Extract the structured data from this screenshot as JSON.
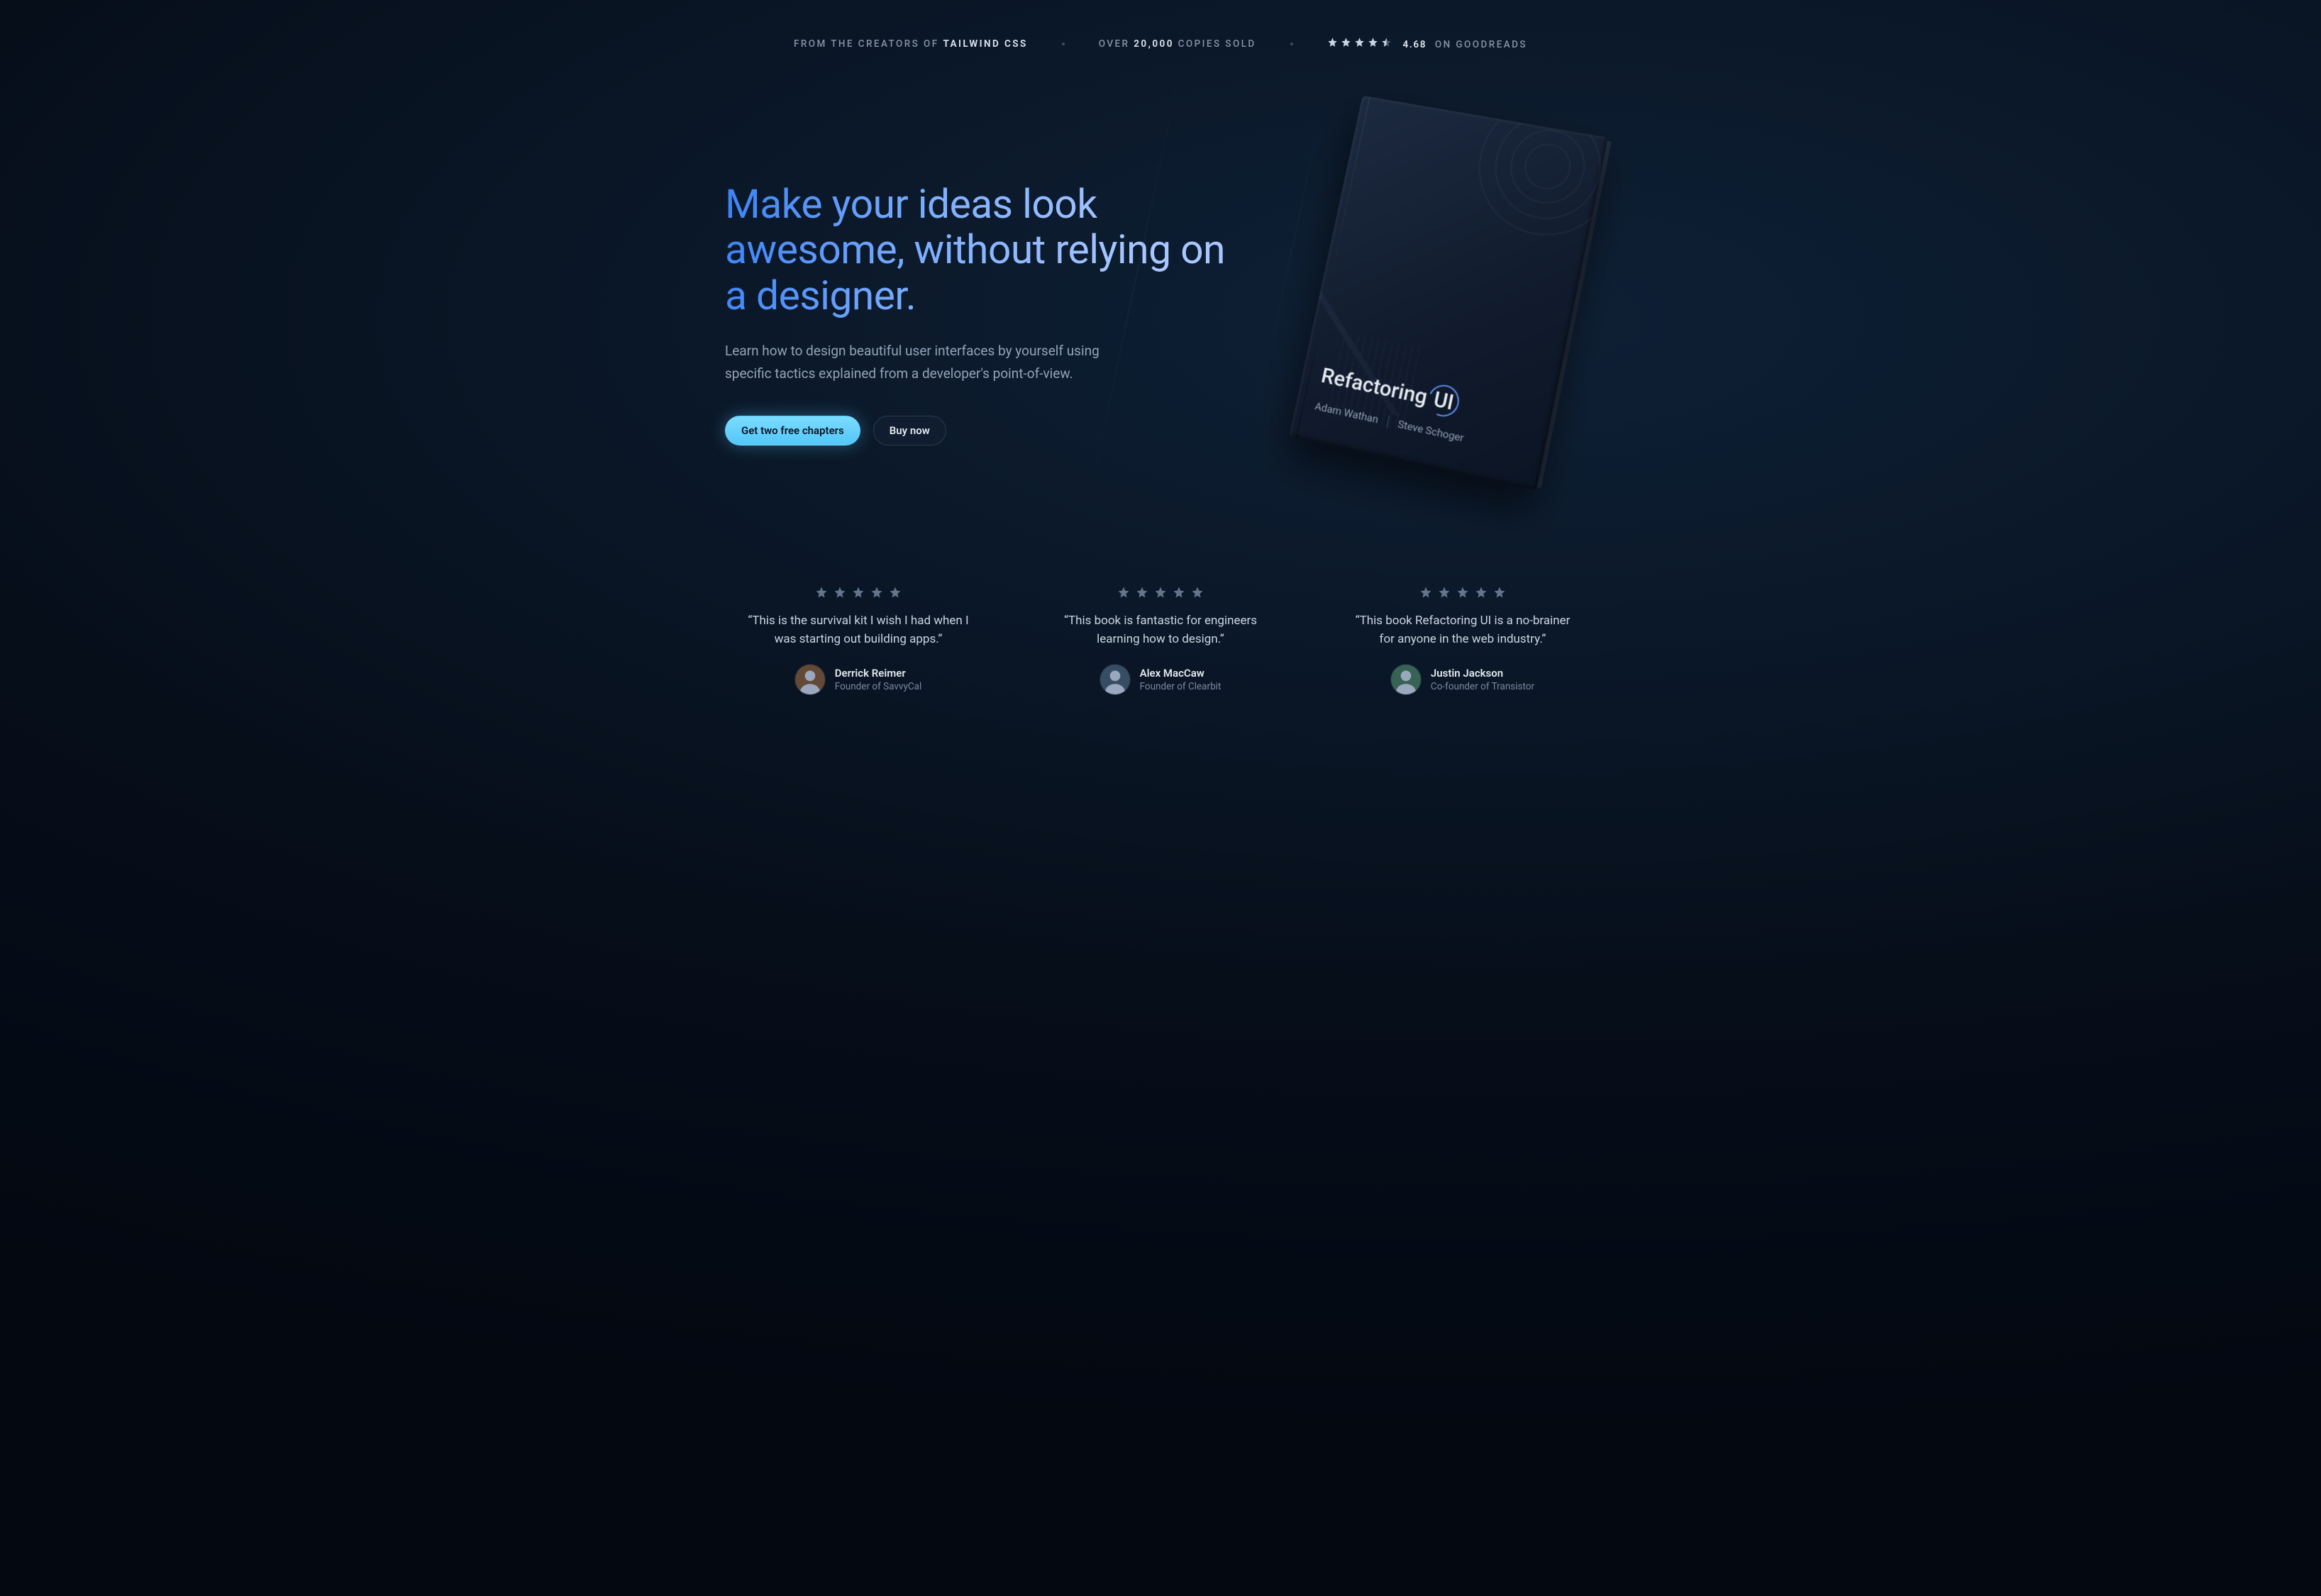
{
  "topbar": {
    "creators_prefix": "From the creators of ",
    "creators_brand": "Tailwind CSS",
    "copies_prefix": "Over ",
    "copies_number": "20,000",
    "copies_suffix": " copies sold",
    "rating_value": "4.68",
    "rating_suffix": " on Goodreads",
    "rating_stars": 4.5
  },
  "hero": {
    "headline": "Make your ideas look awesome, without relying on a designer.",
    "subhead": "Learn how to design beautiful user interfaces by yourself using specific tactics explained from a developer's point-of-view.",
    "cta_primary": "Get two free chapters",
    "cta_secondary": "Buy now"
  },
  "book": {
    "title_part1": "Refactoring",
    "title_part2": "UI",
    "author1": "Adam Wathan",
    "author2": "Steve Schoger"
  },
  "testimonials": [
    {
      "stars": 5,
      "quote": "“This is the survival kit I wish I had when I was starting out building apps.”",
      "name": "Derrick Reimer",
      "role": "Founder of SavvyCal",
      "avatar_hue": 25
    },
    {
      "stars": 5,
      "quote": "“This book is fantastic for engineers learning how to design.”",
      "name": "Alex MacCaw",
      "role": "Founder of Clearbit",
      "avatar_hue": 210
    },
    {
      "stars": 5,
      "quote": "“This book Refactoring UI is a no-brainer for anyone in the web industry.”",
      "name": "Justin Jackson",
      "role": "Co-founder of Transistor",
      "avatar_hue": 160
    }
  ]
}
